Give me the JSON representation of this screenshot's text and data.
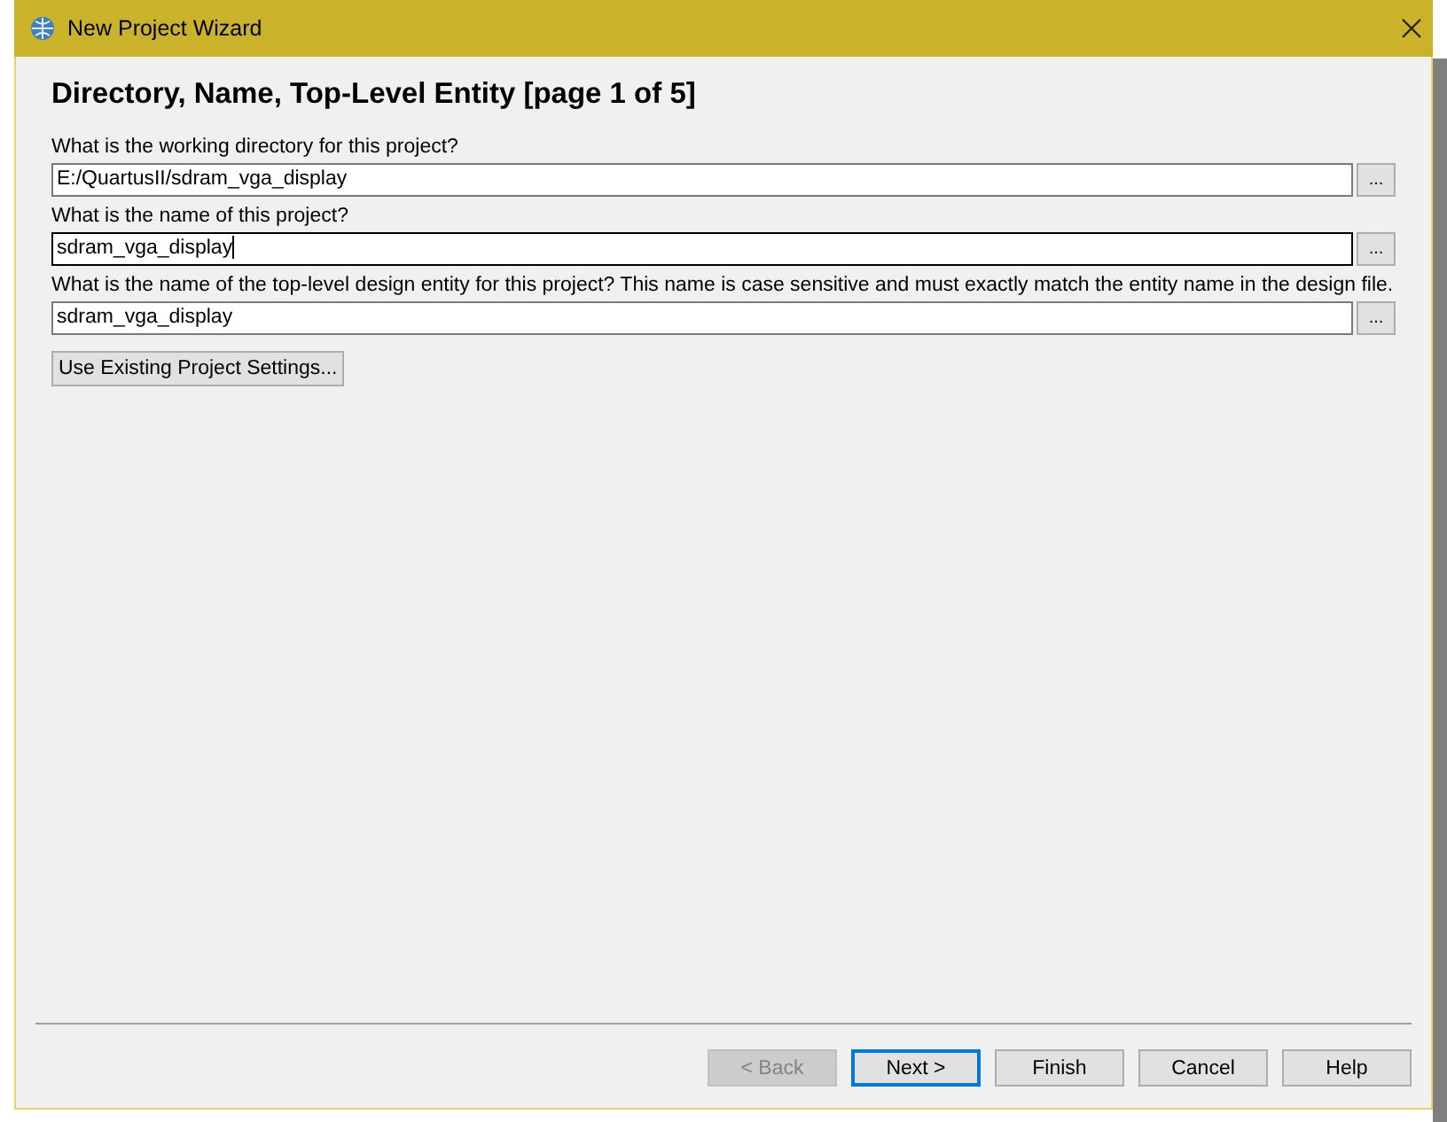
{
  "window": {
    "title": "New Project Wizard"
  },
  "heading": "Directory, Name, Top-Level Entity [page 1 of 5]",
  "fields": [
    {
      "label": "What is the working directory for this project?",
      "value": "E:/QuartusII/sdram_vga_display",
      "focused": false,
      "browse": "..."
    },
    {
      "label": "What is the name of this project?",
      "value": "sdram_vga_display",
      "focused": true,
      "browse": "..."
    },
    {
      "label": "What is the name of the top-level design entity for this project? This name is case sensitive and must exactly match the entity name in the design file.",
      "value": "sdram_vga_display",
      "focused": false,
      "browse": "..."
    }
  ],
  "existing_settings_button": "Use Existing Project Settings...",
  "buttons": [
    {
      "label": "< Back",
      "disabled": true,
      "default": false
    },
    {
      "label": "Next >",
      "disabled": false,
      "default": true
    },
    {
      "label": "Finish",
      "disabled": false,
      "default": false
    },
    {
      "label": "Cancel",
      "disabled": false,
      "default": false
    },
    {
      "label": "Help",
      "disabled": false,
      "default": false
    }
  ]
}
